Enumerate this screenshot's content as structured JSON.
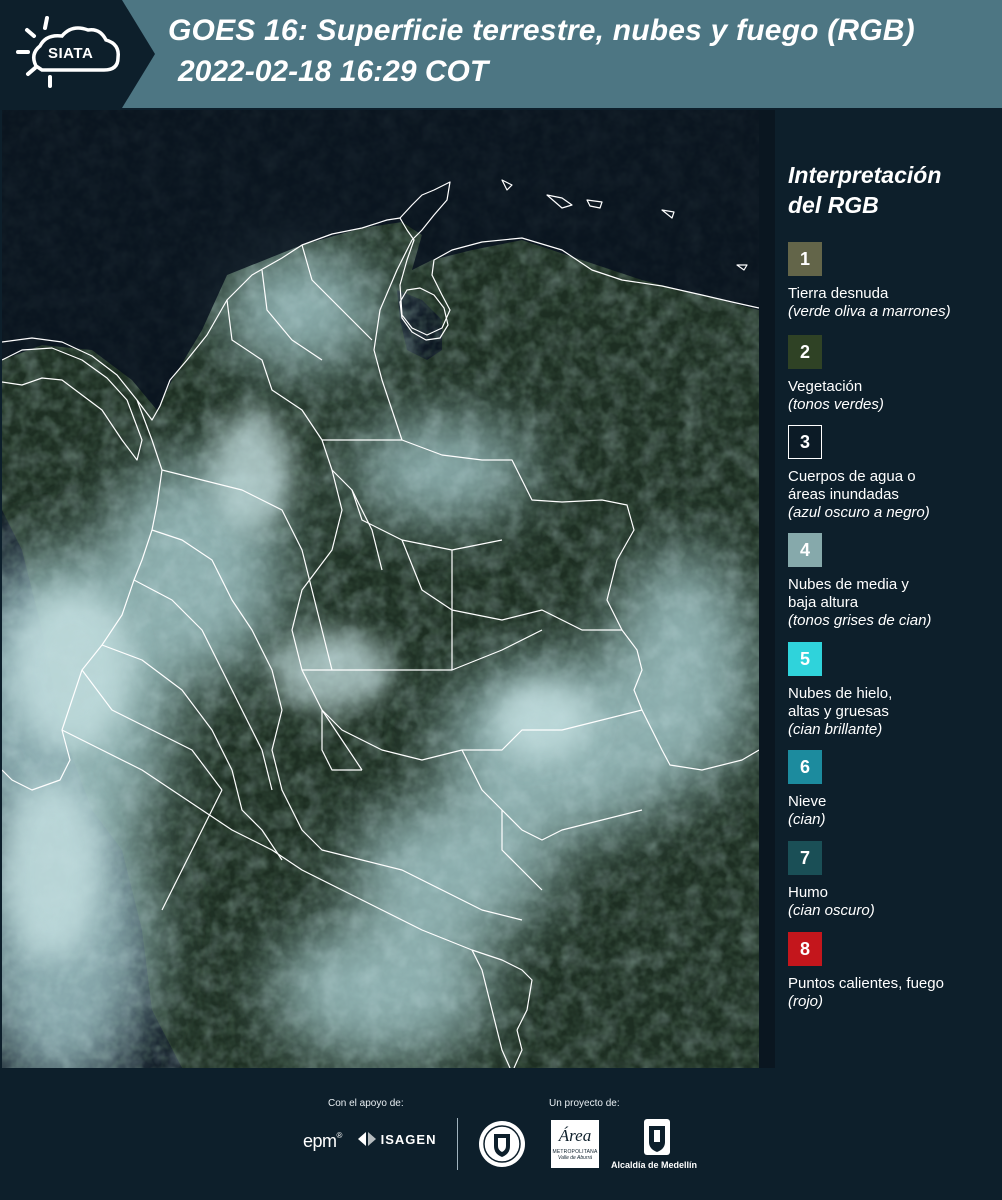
{
  "header": {
    "logo_text": "SIATA",
    "title_line1": "GOES 16: Superficie terrestre, nubes y fuego (RGB)",
    "title_line2": "2022-02-18 16:29 COT",
    "background_color": "#4d7683",
    "logo_background_color": "#0d1f2b"
  },
  "map": {
    "description_icon": "satellite-rgb-map",
    "border_color": "#ffffff"
  },
  "legend": {
    "title_line1": "Interpretación",
    "title_line2": "del RGB",
    "items": [
      {
        "number": "1",
        "label_lines": [
          "Tierra desnuda"
        ],
        "note": "(verde oliva a marrones)",
        "color": "#636549"
      },
      {
        "number": "2",
        "label_lines": [
          "Vegetación"
        ],
        "note": "(tonos verdes)",
        "color": "#2f4225"
      },
      {
        "number": "3",
        "label_lines": [
          "Cuerpos de agua o",
          "áreas inundadas"
        ],
        "note": "(azul oscuro a negro)",
        "color": "#0c1b26"
      },
      {
        "number": "4",
        "label_lines": [
          "Nubes de media y",
          "baja altura"
        ],
        "note": "(tonos grises de cian)",
        "color": "#86a9ab"
      },
      {
        "number": "5",
        "label_lines": [
          "Nubes de hielo,",
          "altas y gruesas"
        ],
        "note": "(cian brillante)",
        "color": "#2fd3db"
      },
      {
        "number": "6",
        "label_lines": [
          "Nieve"
        ],
        "note": "(cian)",
        "color": "#1c8b9e"
      },
      {
        "number": "7",
        "label_lines": [
          "Humo"
        ],
        "note": "(cian oscuro)",
        "color": "#1a4f56"
      },
      {
        "number": "8",
        "label_lines": [
          "Puntos calientes, fuego"
        ],
        "note": "(rojo)",
        "color": "#c4161c"
      }
    ]
  },
  "footer": {
    "support_caption": "Con el apoyo de:",
    "project_caption": "Un proyecto de:",
    "partners": {
      "epm": "epm",
      "isagen": "ISAGEN",
      "area_name": "Área",
      "area_sub1": "METROPOLITANA",
      "area_sub2": "Valle de Aburrá",
      "alcaldia": "Alcaldía de Medellín"
    }
  }
}
